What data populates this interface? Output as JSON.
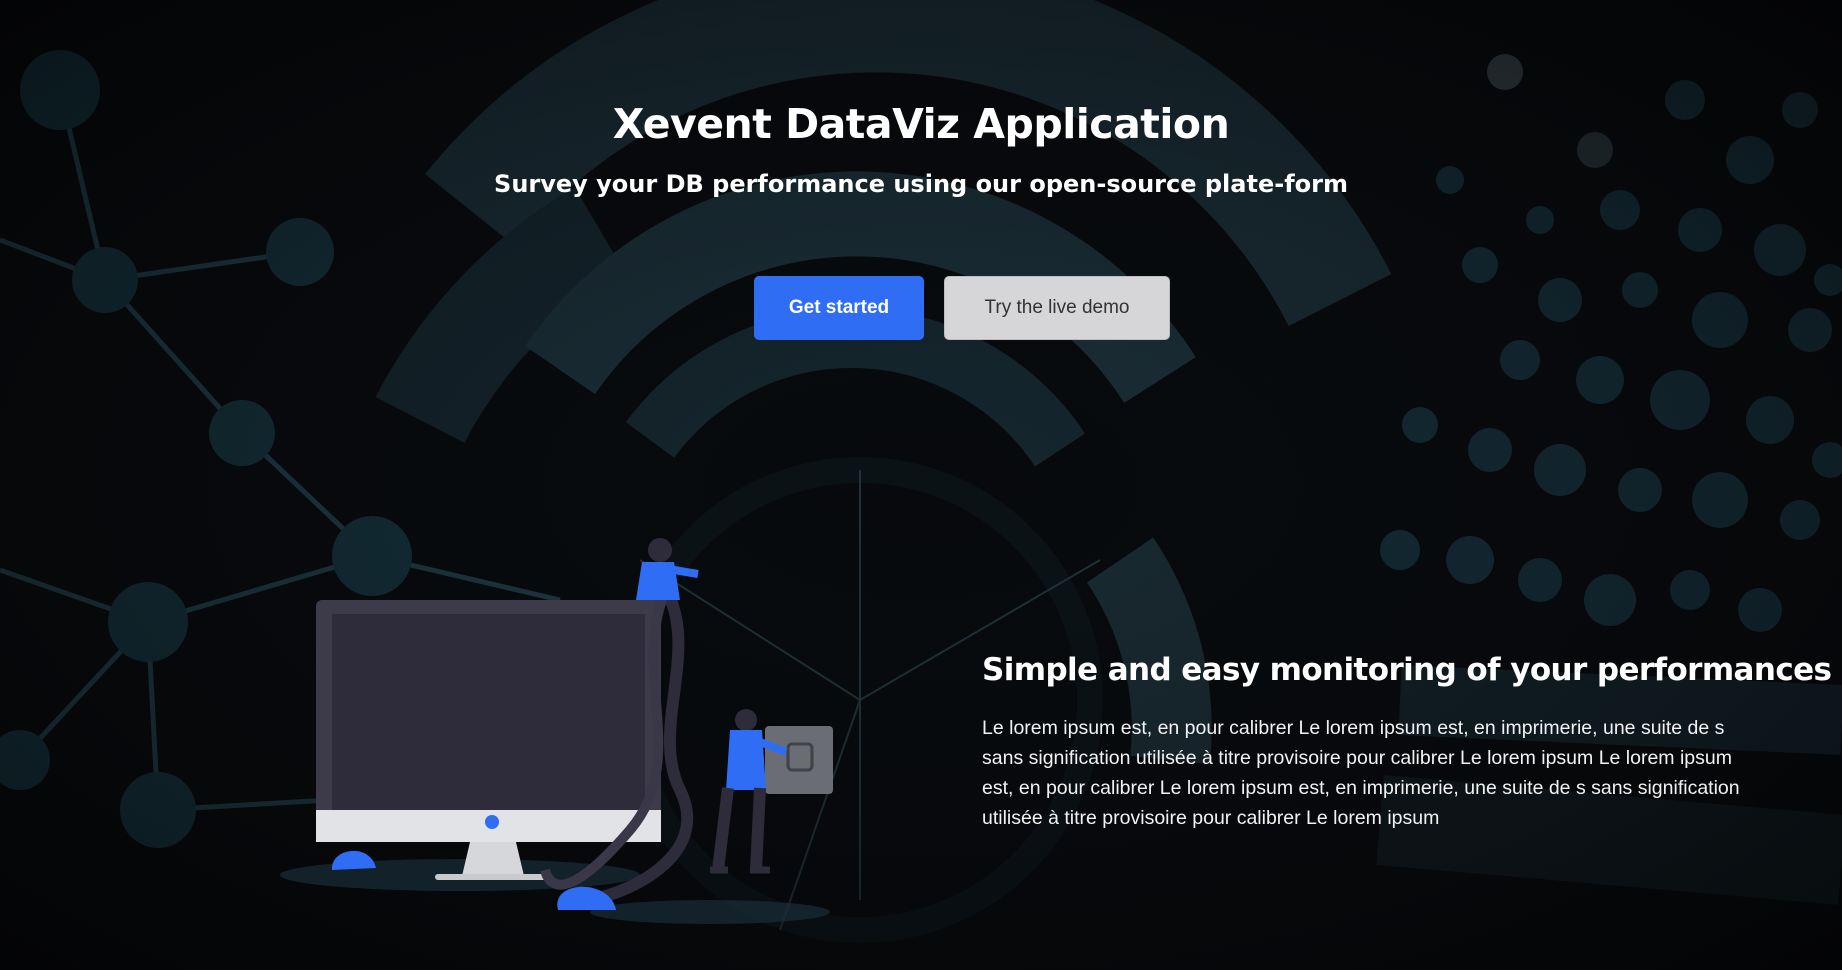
{
  "hero": {
    "title": "Xevent DataViz Application",
    "subtitle": "Survey your DB performance using our open-source plate-form"
  },
  "buttons": {
    "primary_label": "Get started",
    "secondary_label": "Try the live demo"
  },
  "feature": {
    "heading": "Simple and easy monitoring of your performances",
    "body": "Le lorem ipsum est, en pour calibrer Le lorem ipsum est, en imprimerie, une suite de s sans signification utilisée à titre provisoire pour calibrer Le lorem ipsum Le lorem ipsum est, en pour calibrer Le lorem ipsum est, en imprimerie, une suite de s sans signification utilisée à titre provisoire pour calibrer Le lorem ipsum"
  },
  "colors": {
    "background": "#07090c",
    "accent": "#2f6df5",
    "secondary_button": "#d6d6d8",
    "graphic_teal": "#1c3540"
  },
  "icons": {
    "illustration": "computer-plug-illustration",
    "background": "network-radial-chart-background"
  }
}
